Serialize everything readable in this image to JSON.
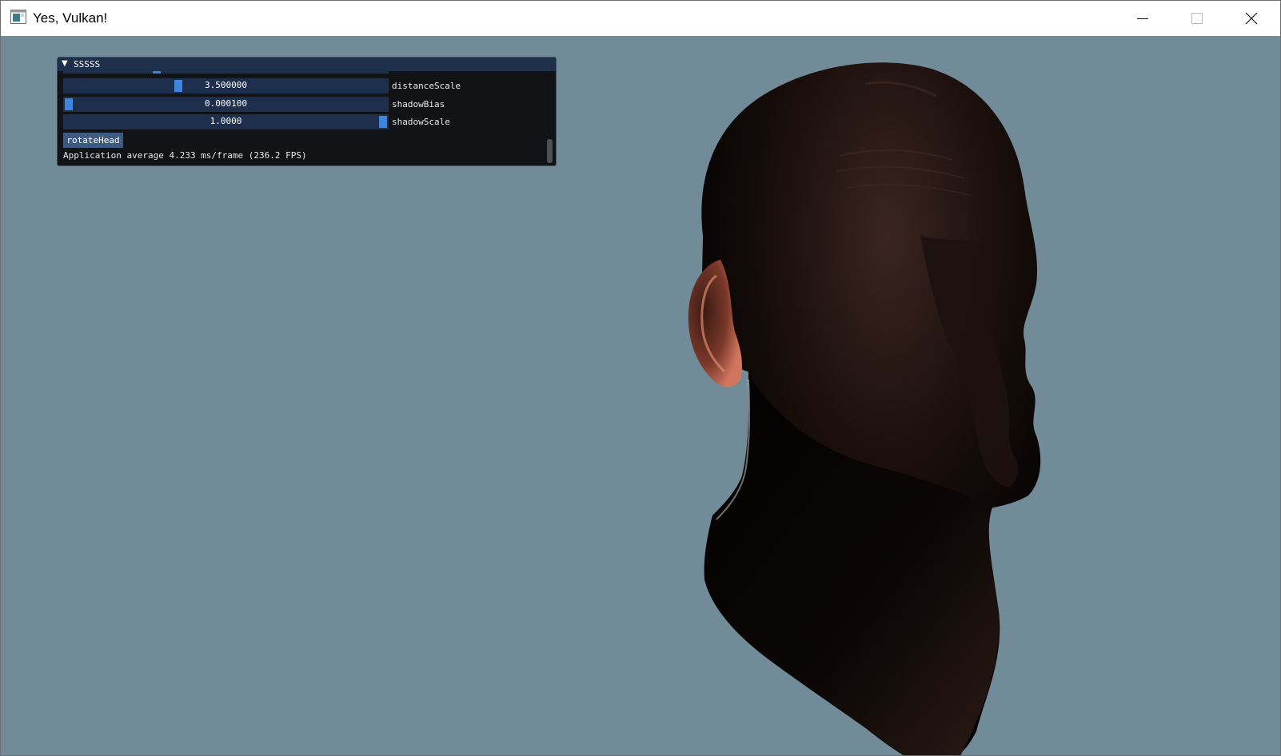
{
  "window": {
    "title": "Yes, Vulkan!",
    "app_icon": "vulkan-window-icon",
    "controls": [
      "minimize-icon",
      "maximize-icon",
      "close-icon"
    ]
  },
  "viewport": {
    "background_color": "#718b98",
    "scene": "rendered-human-head"
  },
  "imgui": {
    "panel_title": "SSSSS",
    "collapse_icon": "triangle-down-icon",
    "sliders": [
      {
        "label": "distanceScale",
        "value": "3.500000",
        "level": 0.35
      },
      {
        "label": "shadowBias",
        "value": "0.000100",
        "level": 0.0
      },
      {
        "label": "shadowScale",
        "value": "1.0000",
        "level": 1.0
      }
    ],
    "button_label": "rotateHead",
    "status": "Application average 4.233 ms/frame (236.2 FPS)",
    "accent_color": "#3d86e0",
    "frame_color": "#1d2f4d"
  }
}
